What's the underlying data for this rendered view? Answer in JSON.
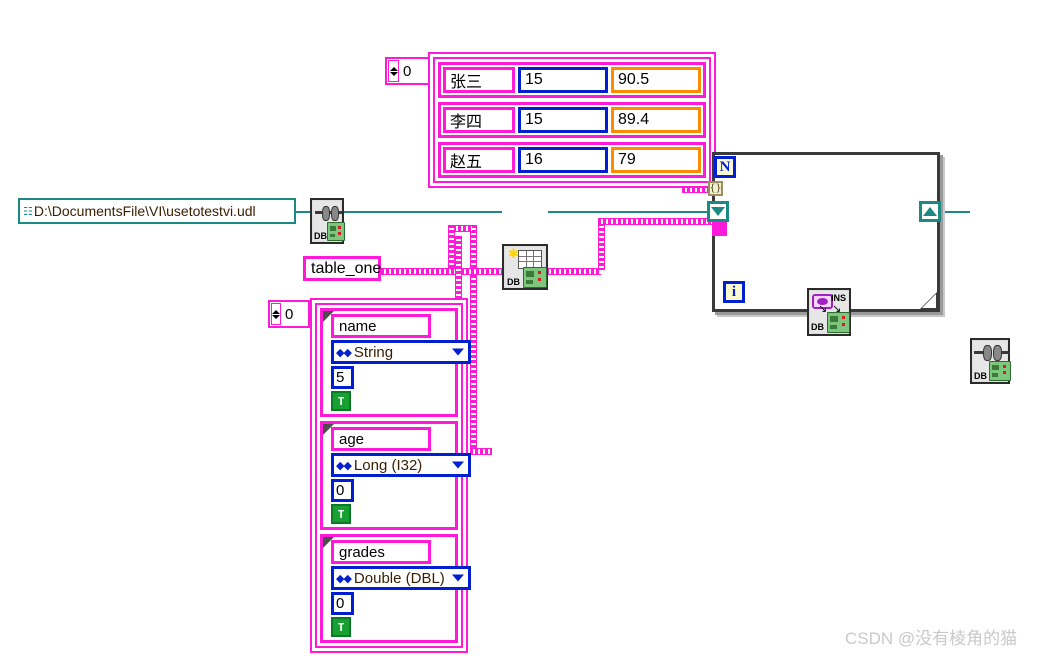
{
  "diagram": {
    "title": "LabVIEW Block Diagram - Database Insert",
    "watermark": "CSDN @没有棱角的猫"
  },
  "path_control": {
    "name": "connection-path-constant",
    "value": "D:\\DocumentsFile\\VI\\usetotestvi.udl",
    "glyph": "⑆"
  },
  "data_array": {
    "index_value": "0",
    "rows": [
      {
        "name": "张三",
        "age": "15",
        "grade": "90.5"
      },
      {
        "name": "李四",
        "age": "15",
        "grade": "89.4"
      },
      {
        "name": "赵五",
        "age": "16",
        "grade": "79"
      }
    ]
  },
  "table_name_constant": {
    "value": "table_one"
  },
  "schema_array": {
    "index_value": "0",
    "clusters": [
      {
        "field_name": "name",
        "type": "String",
        "size": "5",
        "bool": "T"
      },
      {
        "field_name": "age",
        "type": "Long (I32)",
        "size": "0",
        "bool": "T"
      },
      {
        "field_name": "grades",
        "type": "Double (DBL)",
        "size": "0",
        "bool": "T"
      }
    ]
  },
  "for_loop": {
    "count_terminal": "N",
    "iteration_terminal": "i",
    "tunnel_label": "{}"
  },
  "vis": {
    "open_connection": {
      "label": "DB",
      "title": "DB Tools Open Connection"
    },
    "create_table": {
      "label": "DB",
      "title": "DB Tools Create Table"
    },
    "insert_data": {
      "label": "DB",
      "title": "DB Tools Insert Data",
      "badge": "INS"
    },
    "close_connection": {
      "label": "DB",
      "title": "DB Tools Close Connection"
    }
  },
  "colors": {
    "string_wire": "#ff1ad9",
    "refnum_wire": "#1a8a82",
    "integer_border": "#0020d0",
    "double_border": "#ff8c00",
    "structure_border": "#3a3a3a",
    "boolean_green": "#18a032"
  }
}
